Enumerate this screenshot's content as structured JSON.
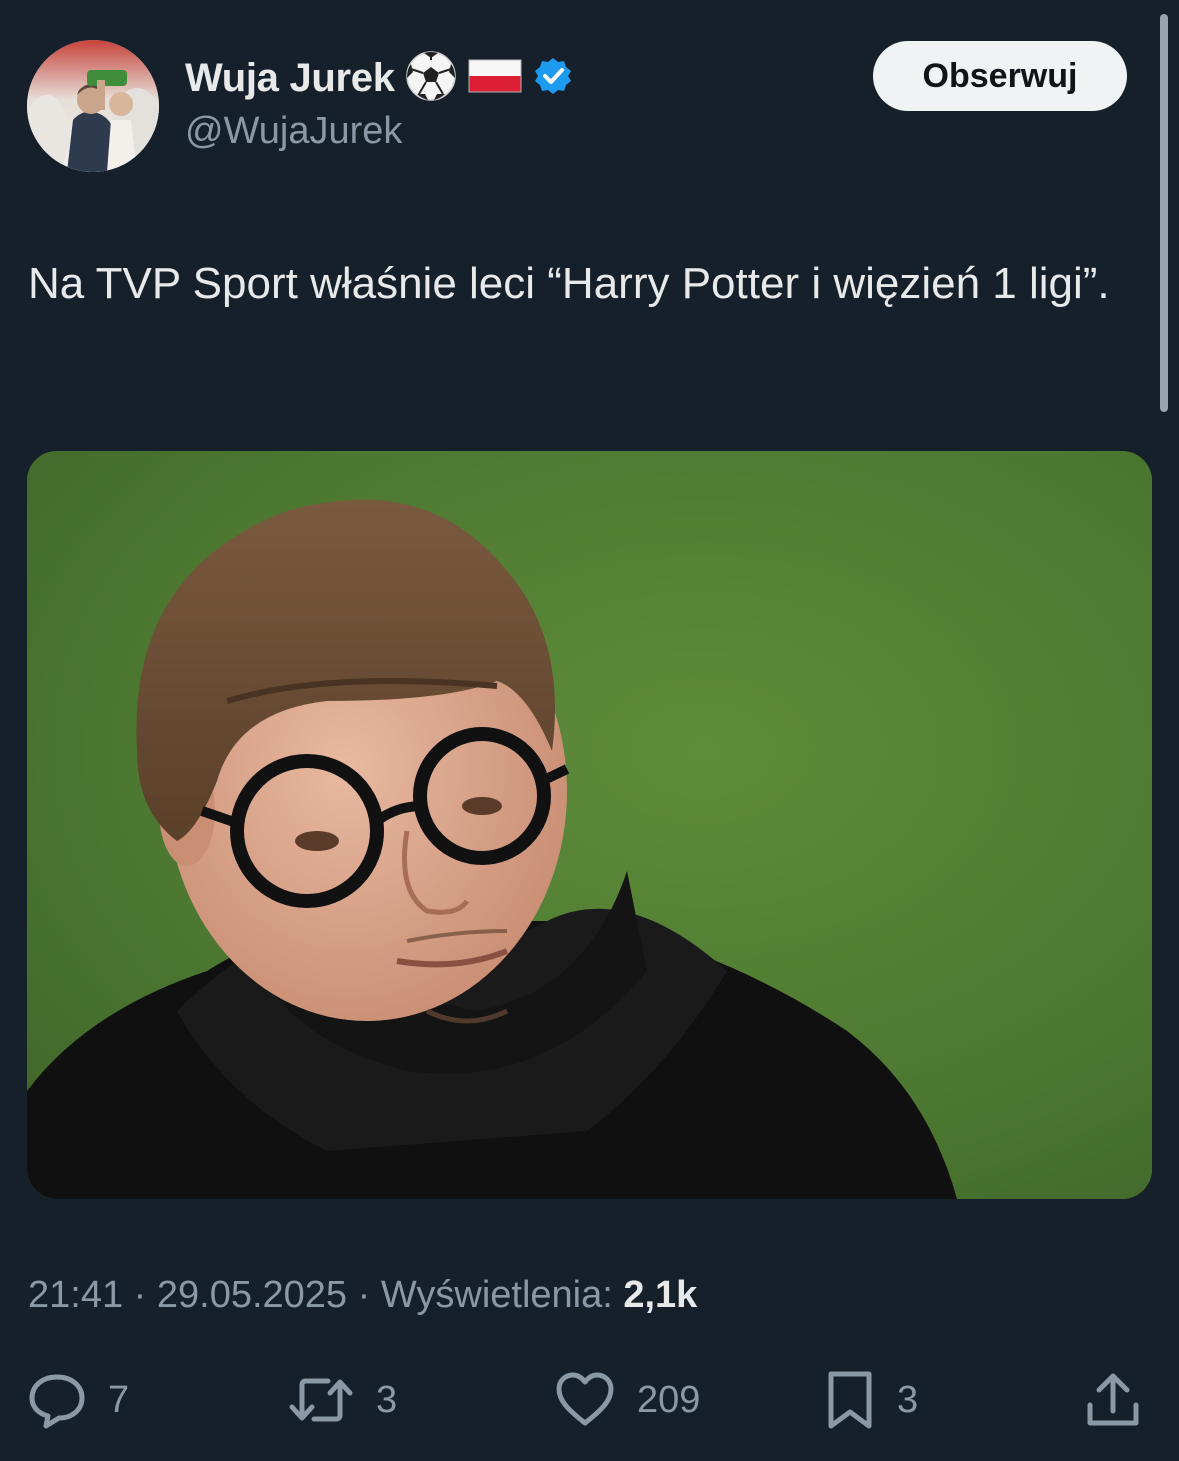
{
  "author": {
    "display_name": "Wuja Jurek",
    "handle": "@WujaJurek",
    "badges": [
      "soccer-ball-icon",
      "poland-flag-icon",
      "verified-badge-icon"
    ]
  },
  "follow_label": "Obserwuj",
  "tweet": {
    "text": "Na TVP Sport właśnie leci “Harry Potter i więzień 1 ligi”."
  },
  "meta": {
    "time": "21:41",
    "date": "29.05.2025",
    "views_label": "Wyświetlenia:",
    "views_count": "2,1k"
  },
  "actions": {
    "replies": "7",
    "reposts": "3",
    "likes": "209",
    "bookmarks": "3"
  },
  "colors": {
    "background": "#15202b",
    "text_primary": "#e7e9ea",
    "text_secondary": "#8b98a5",
    "verified_blue": "#1d9bf0"
  }
}
